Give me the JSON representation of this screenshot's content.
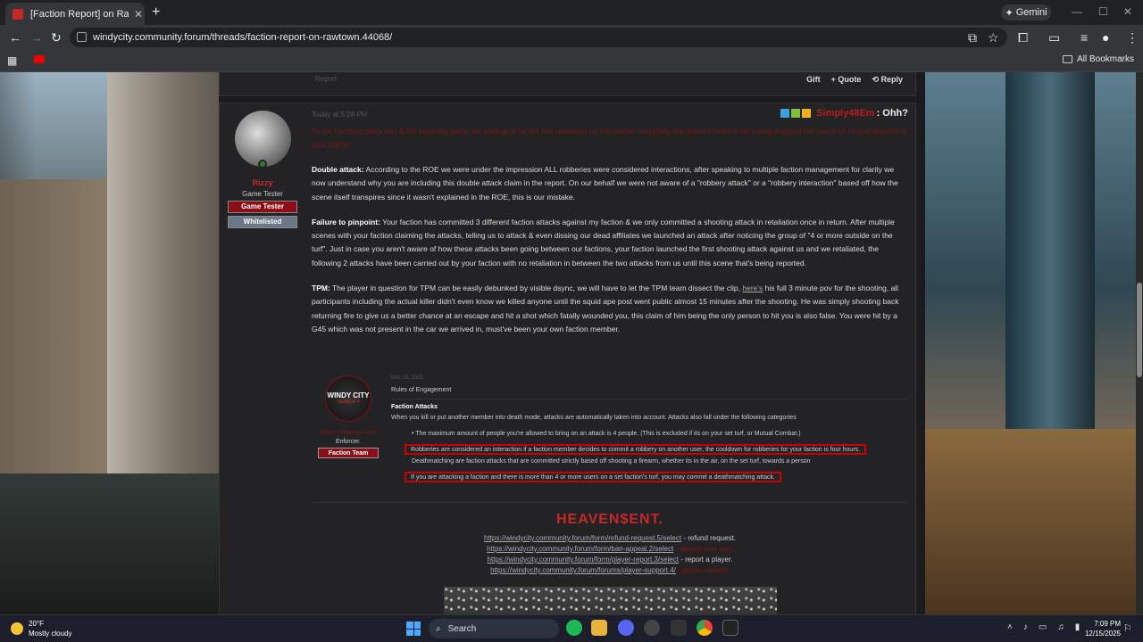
{
  "browser": {
    "tab_title": "[Faction Report] on Rawtown | W",
    "tab_close": "✕",
    "new_tab": "+",
    "gemini_label": "Gemini",
    "url": "windycity.community.forum/threads/faction-report-on-rawtown.44068/",
    "all_bookmarks": "All Bookmarks",
    "win_min": "—",
    "win_max": "☐",
    "win_close": "✕"
  },
  "prev_post": {
    "report_label": "Report",
    "gift_label": "Gift",
    "quote_label": "+ Quote",
    "reply_label": "Reply"
  },
  "post": {
    "date": "Today at 5:08 PM",
    "signature_name": "Simply48Em",
    "signature_suffix": ": Ohh?",
    "user": {
      "name": "Rizzy",
      "title": "Game Tester",
      "badges": [
        "Game Tester",
        "Whitelisted"
      ]
    },
    "intro": "To the handling party and & the reporting party, we apologize for the late response on this matter. Hopefully this doesn't need to be a long dragged out report so I'll just respond to your claims.",
    "paragraphs": [
      {
        "label": "Double attack:",
        "text": " According to the ROE we were under the impression ALL robberies were considered interactions, after speaking to multiple faction management for clarity we now understand why you are including this double attack claim in the report. On our behalf we were not aware of a \"robbery attack\" or a \"robbery interaction\" based off how the scene itself transpires since it wasn't explained in the ROE, this is our mistake."
      },
      {
        "label": "Failure to pinpoint:",
        "text": " Your faction has committed 3 different faction attacks against my faction & we only committed a shooting attack in retaliation once in return. After multiple scenes with your faction claiming the attacks, telling us to attack & even dissing our dead affiliates we launched an attack after noticing the group of \"4 or more outside on the turf\". Just in case you aren't aware of how these attacks been going between our factions, your faction launched the first shooting attack against us and we retaliated, the following 2 attacks have been carried out by your faction with no retaliation in between the two attacks from us until this scene that's being reported."
      }
    ],
    "tpm": {
      "label": "TPM:",
      "text_before": " The player in question for TPM can be easily debunked by visible dsync, we will have to let the TPM team dissect the clip, ",
      "link": "here's",
      "text_after": " his full 3 minute pov for the shooting, all participants including the actual killer didn't even know we killed anyone until the squid ape post went public almost 15 minutes after the shooting. He was simply shooting back returning fire to give us a better chance at an escape and hit a shot which fatally wounded you, this claim of him being the only person to hit you is also false. You were hit by a G45 which was not present in the car we arrived in, must've been your own faction member."
    },
    "quote": {
      "logo_line1": "WINDY CITY",
      "logo_line2": "SEASON 4",
      "user_name": "Admin Management",
      "user_role": "Enforcer.",
      "user_badge": "Faction Team",
      "date": "Dec 15, 2025",
      "heading": "Rules of Engagement",
      "subheading": "Faction Attacks",
      "text": "When you kill or put another member into death mode, attacks are automatically taken into account. Attacks also fall under the following categories",
      "items": [
        "The maximum amount of people you're allowed to bring on an attack is 4 people. (This is excluded if its on your set turf, or Mutual Combat.)",
        "Robberies are considered an interaction if a faction member decides to commit a robbery on another user, the cooldown for robberies for your faction is four hours.",
        "Deathmatching are faction attacks that are committed strictly based off shooting a firearm, whether its in the air, on the set turf, towards a person",
        "If you are attacking a faction and there is more than 4 or more users on a set faction's turf, you may commit a deathmatching attack."
      ]
    },
    "signature_block": {
      "title": "HEAVEN$ENT.",
      "links": [
        {
          "url": "https://windycity.community.forum/form/refund-request.5/select",
          "desc": " - refund request."
        },
        {
          "url": "https://windycity.community.forum/form/ban-appeal.2/select",
          "desc": " - appeal your ban."
        },
        {
          "url": "https://windycity.community.forum/form/player-report.3/select",
          "desc": " - report a player."
        },
        {
          "url": "https://windycity.community.forum/forums/player-support.4/",
          "desc": " - player support."
        }
      ]
    }
  },
  "taskbar": {
    "temp": "20°F",
    "weather": "Mostly cloudy",
    "search_label": "Search",
    "time": "7:09 PM",
    "date": "12/15/2025"
  },
  "colors": {
    "accent_red": "#c62828",
    "forum_bg": "#1b1b1d",
    "post_bg": "#232325"
  }
}
